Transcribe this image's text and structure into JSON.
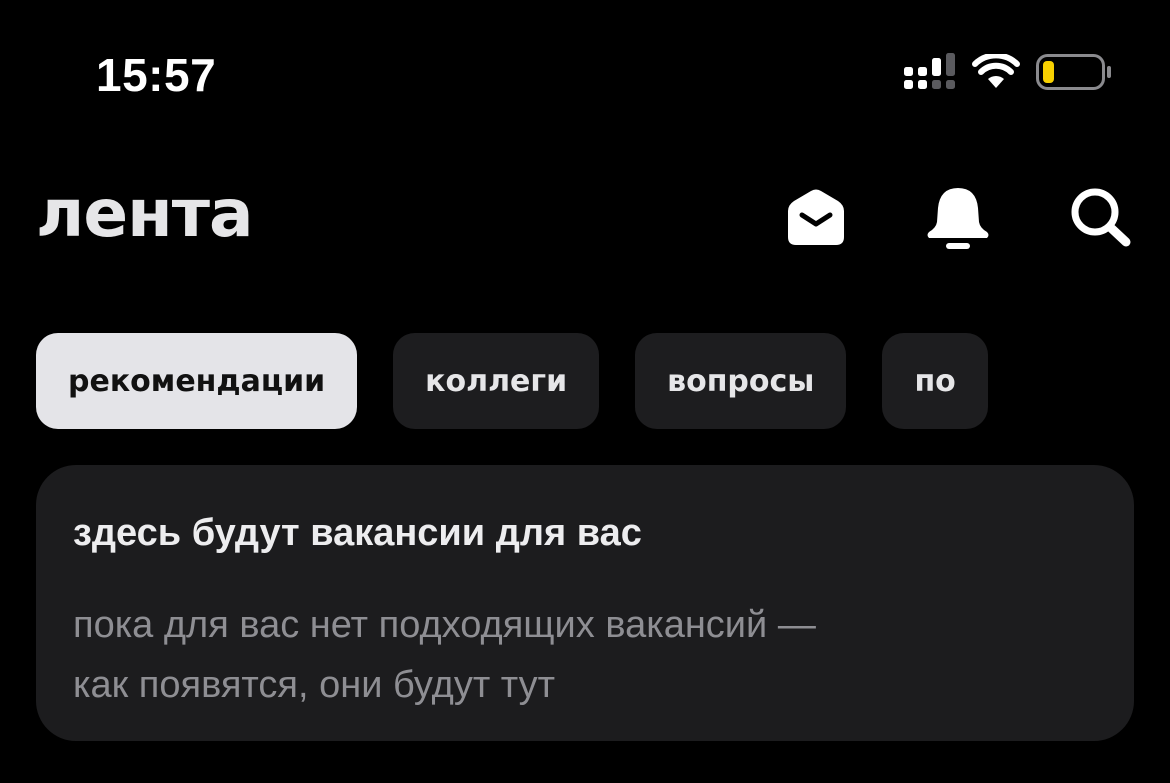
{
  "status_bar": {
    "time": "15:57",
    "icons": [
      "cellular-signal-icon",
      "wifi-icon",
      "battery-low-icon"
    ],
    "battery_color": "#f7d000"
  },
  "header": {
    "title": "лента",
    "actions": [
      "messages-icon",
      "bell-icon",
      "search-icon"
    ]
  },
  "tabs": [
    {
      "label": "рекомендации",
      "active": true
    },
    {
      "label": "коллеги",
      "active": false
    },
    {
      "label": "вопросы",
      "active": false
    },
    {
      "label": "по",
      "active": false
    }
  ],
  "card": {
    "title": "здесь будут вакансии для вас",
    "text_line1": "пока для вас нет подходящих вакансий —",
    "text_line2": "как появятся, они будут тут"
  },
  "colors": {
    "background": "#000000",
    "surface": "#1c1c1e",
    "active_tab": "#e4e4e8",
    "secondary_text": "#8e8e93"
  }
}
